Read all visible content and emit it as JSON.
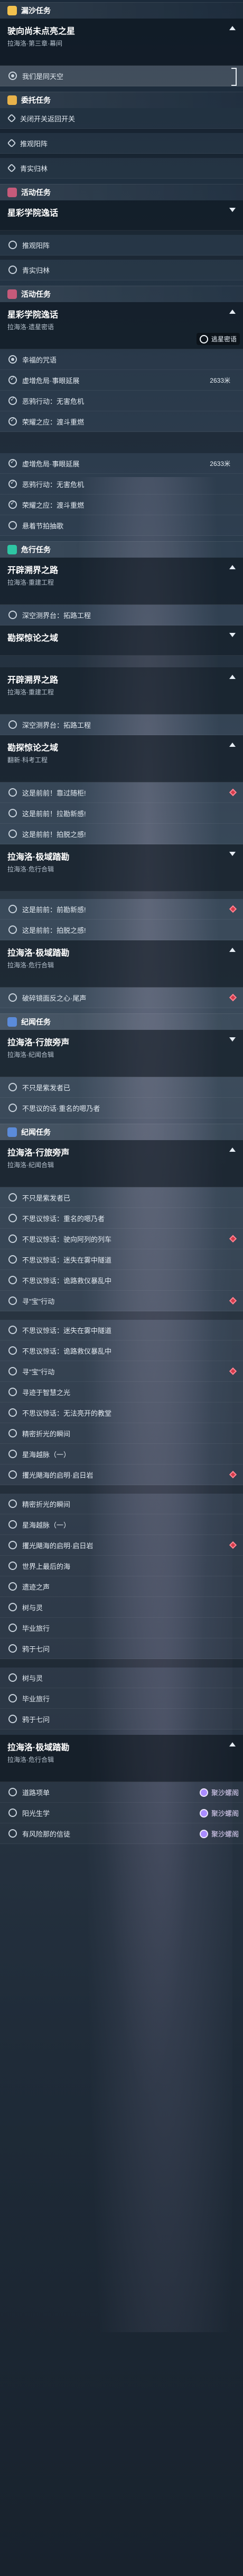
{
  "colors": {
    "accent_daily": "#f2c14e",
    "accent_quest": "#e8b24a",
    "accent_event": "#c65a7a",
    "accent_side": "#2ec6a3",
    "accent_chronicle": "#5b8bd9",
    "pin_red": "#d23a4a",
    "vote_purple": "#a98bff"
  },
  "sections": {
    "s1": {
      "label": "漏沙任务",
      "icon": "star-icon"
    },
    "s2": {
      "label": "委托任务",
      "icon": "star-icon"
    },
    "s3": {
      "label": "活动任务",
      "icon": "star-icon"
    },
    "s4": {
      "label": "活动任务",
      "icon": "star-icon"
    },
    "s5": {
      "label": "危行任务",
      "icon": "star-icon"
    },
    "s6": {
      "label": "纪闻任务",
      "icon": "star-icon"
    },
    "s7": {
      "label": "纪闻任务",
      "icon": "star-icon"
    }
  },
  "cards": {
    "c1": {
      "title": "驶向尚未点亮之星",
      "sub": "拉海洛·第三章·幕间"
    },
    "c2": {
      "title": "星彩学院逸话",
      "sub": ""
    },
    "c3": {
      "title": "星彩学院逸话",
      "sub": "拉海洛·遗星密语"
    },
    "c4": {
      "title": "开辟溯界之路",
      "sub": "拉海洛·重建工程"
    },
    "c5": {
      "title": "勘探惊论之域",
      "sub": ""
    },
    "c6": {
      "title": "开辟溯界之路",
      "sub": "拉海洛·重建工程"
    },
    "c7": {
      "title": "勘探惊论之域",
      "sub": "翻新·科考工程"
    },
    "c8": {
      "title": "拉海洛·极域踏勘",
      "sub": "拉海洛·危行合辑"
    },
    "c9": {
      "title": "拉海洛·极域踏勘",
      "sub": "拉海洛·危行合辑"
    },
    "c10": {
      "title": "拉海洛·行旅旁声",
      "sub": "拉海洛·纪闻合辑"
    },
    "c11": {
      "title": "拉海洛·行旅旁声",
      "sub": "拉海洛·纪闻合辑"
    },
    "c12": {
      "title": "拉海洛·极域踏勘",
      "sub": "拉海洛·危行合辑"
    }
  },
  "rows": {
    "r1": "我们是同天空",
    "r2": "关闭开关返回开关",
    "r3": "推观阳阵",
    "r4": "青实归林",
    "r5": "推观阳阵",
    "r6": "青实归林",
    "r7": "幸福的咒语",
    "r8": "虚增危局·事眼延展",
    "r8_meta": "2633米",
    "r9": "恶鸦行动：无害危机",
    "r10": "荣耀之应：渡斗重燃",
    "r11": "虚增危局·事眼延展",
    "r11_meta": "2633米",
    "r12": "恶鸦行动：无害危机",
    "r13": "荣耀之应：渡斗重燃",
    "r14": "悬着节拍抽歌",
    "r15": "深空测界台：拓路工程",
    "r16": "深空测界台：拓路工程",
    "r17": "这是前前！靠过随柜!",
    "r18": "这是前前！拉勘新感!",
    "r19": "这是前前！拍脱之感!",
    "r20": "这是前前：前勘新感!",
    "r21": "这是前前：拍脱之感!",
    "r22": "破碎镜面反之心·尾声",
    "r23": "不只是紫发者已",
    "r24": "不思议的话·重名的嗯乃者",
    "r25": "不只是紫发者已",
    "r26": "不思议惊话：重名的嗯乃者",
    "r27": "不思议惊话：驶向阿列的列车",
    "r28": "不思议惊话：迷失在雾中隧道",
    "r29": "不思议惊话：诡路救仪暴乱中",
    "r30": "寻\"宝\"行动",
    "r31": "不思议惊话：迷失在雾中隧道",
    "r32": "不思议惊话：诡路救仪暴乱中",
    "r33": "寻\"宝\"行动",
    "r34": "寻迹于智慧之光",
    "r35": "不思议惊话：无法亮开的教堂",
    "r36": "精密折光的瞬间",
    "r37": "星海越脉（一）",
    "r38": "攫光飓海的启明·启日岩",
    "r39": "精密折光的瞬间",
    "r40": "星海越脉（一）",
    "r41": "攫光飓海的启明·启日岩",
    "r42": "世界上最后的海",
    "r43": "遗迹之声",
    "r44": "树与灵",
    "r45": "毕业旅行",
    "r46": "鸦于七问",
    "r47": "树与灵",
    "r48": "毕业旅行",
    "r49": "鸦于七问",
    "r50": "道路项单",
    "r51": "阳光生学",
    "r52": "有风险那的信徒"
  },
  "tags": {
    "tag1": "逃星密语",
    "vote1": "聚沙螺阁",
    "vote2": "聚沙螺阁",
    "vote3": "聚沙螺阁",
    "vote4": "聚沙螺阁"
  }
}
